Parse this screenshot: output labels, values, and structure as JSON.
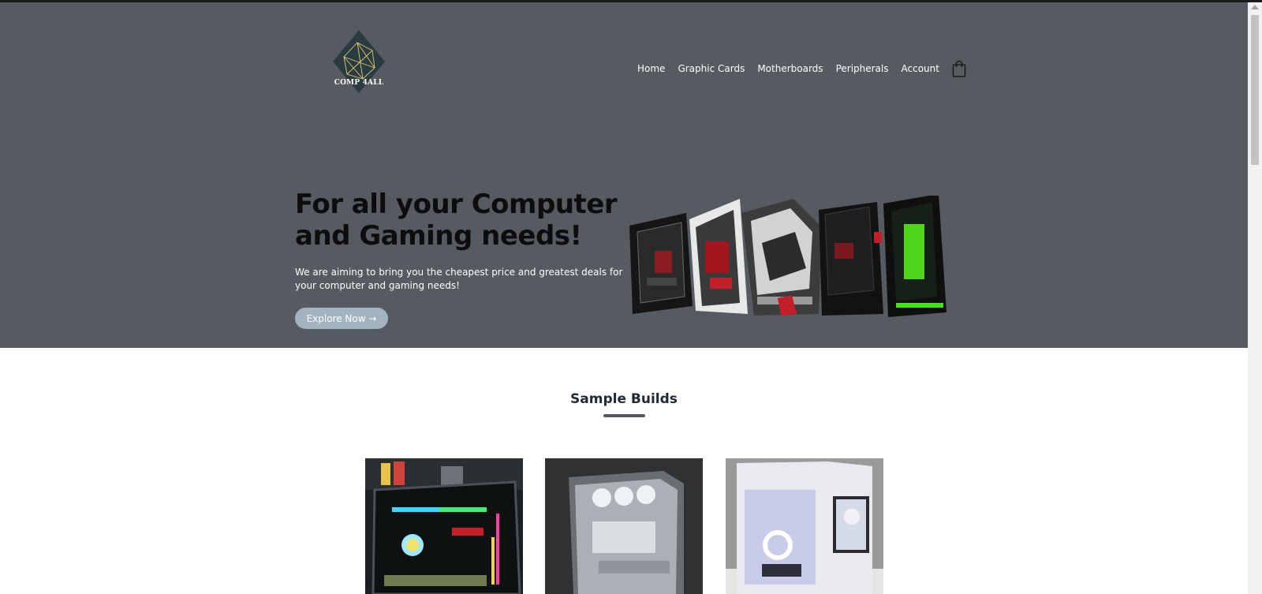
{
  "brand": {
    "logo_text": "COMP 4ALL"
  },
  "nav": {
    "items": [
      {
        "label": "Home"
      },
      {
        "label": "Graphic Cards"
      },
      {
        "label": "Motherboards"
      },
      {
        "label": "Peripherals"
      },
      {
        "label": "Account"
      }
    ],
    "cart_icon": "shopping-bag-icon"
  },
  "hero": {
    "headline": "For all your Computer and Gaming needs!",
    "subtext": "We are aiming to bring you the cheapest price and greatest deals for your computer and gaming needs!",
    "cta_label": "Explore Now →",
    "image": "gaming-pc-lineup"
  },
  "builds_section": {
    "title": "Sample Builds",
    "items": [
      {
        "image": "rgb-black-pc-build"
      },
      {
        "image": "glass-silver-pc-build"
      },
      {
        "image": "white-anime-pc-build"
      }
    ]
  },
  "colors": {
    "hero_bg": "#555b61",
    "accent": "#a3b4c0",
    "heading": "#1f2a33"
  }
}
